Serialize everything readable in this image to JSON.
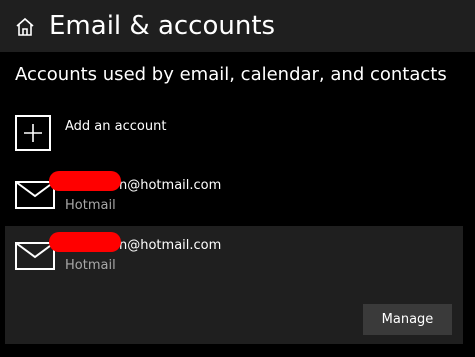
{
  "header": {
    "title": "Email & accounts",
    "icon": "home-icon"
  },
  "section": {
    "title": "Accounts used by email, calendar, and contacts"
  },
  "add_account": {
    "label": "Add an account",
    "icon": "plus-icon"
  },
  "accounts": [
    {
      "email_visible": "n@hotmail.com",
      "type": "Hotmail",
      "icon": "mail-icon",
      "redacted": true
    },
    {
      "email_visible": "n@hotmail.com",
      "type": "Hotmail",
      "icon": "mail-icon",
      "redacted": true,
      "selected": true
    }
  ],
  "manage_button": {
    "label": "Manage"
  },
  "colors": {
    "background": "#000000",
    "header_bg": "#1f1f1f",
    "selected_bg": "#1f1f1f",
    "button_bg": "#3a3a3a",
    "secondary_text": "#a8a8a8",
    "redaction": "#ff0000"
  }
}
